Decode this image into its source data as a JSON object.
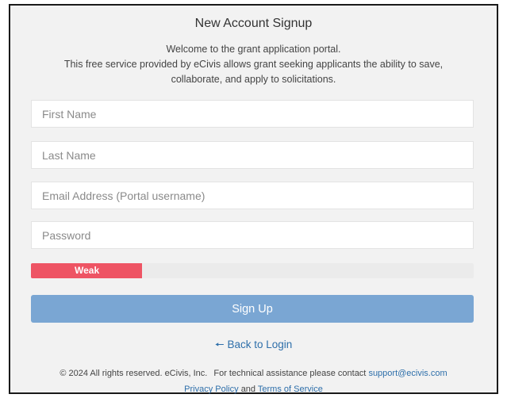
{
  "header": {
    "title": "New Account Signup",
    "intro_line1": "Welcome to the grant application portal.",
    "intro_line2": "This free service provided by eCivis allows grant seeking applicants the ability to save,",
    "intro_line3": "collaborate, and apply to solicitations."
  },
  "form": {
    "first_name_placeholder": "First Name",
    "last_name_placeholder": "Last Name",
    "email_placeholder": "Email Address (Portal username)",
    "password_placeholder": "Password",
    "strength_label": "Weak",
    "strength_fraction": 0.25,
    "strength_color": "#ee5464",
    "signup_label": "Sign Up",
    "signup_color": "#7aa6d3"
  },
  "nav": {
    "back_icon": "arrow-left-icon",
    "back_label": "Back to Login"
  },
  "footer": {
    "copyright": "© 2024 All rights reserved. eCivis, Inc.",
    "assist_text": "For technical assistance please contact",
    "support_email": "support@ecivis.com",
    "privacy_label": "Privacy Policy",
    "and_text": "and",
    "terms_label": "Terms of Service"
  }
}
